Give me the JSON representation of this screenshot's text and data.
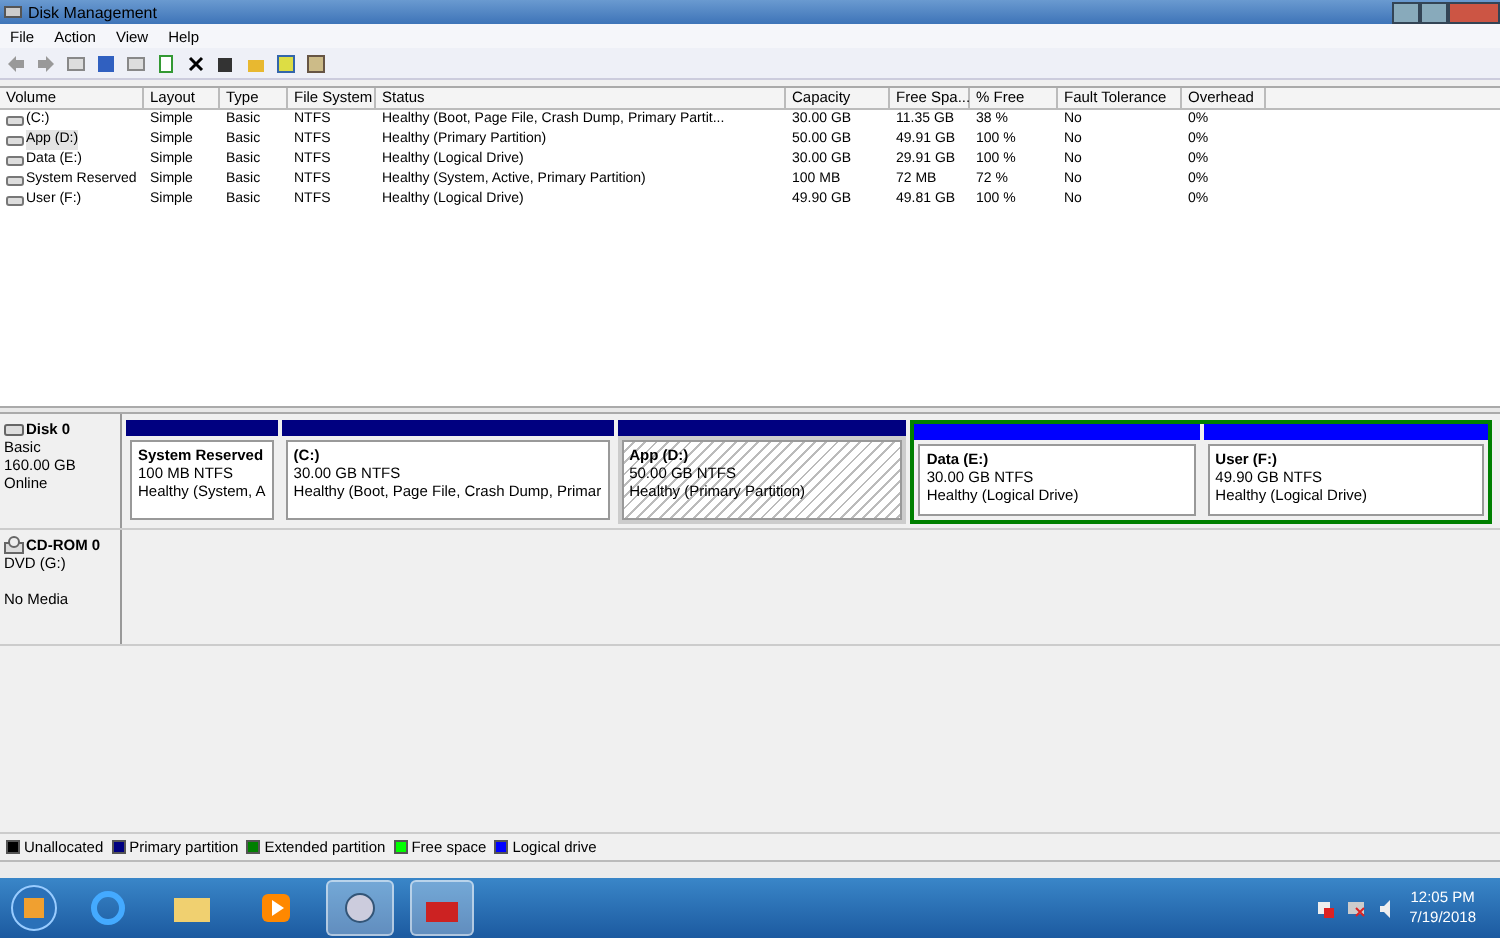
{
  "window": {
    "title": "Disk Management"
  },
  "menu": [
    "File",
    "Action",
    "View",
    "Help"
  ],
  "table": {
    "columns": [
      "Volume",
      "Layout",
      "Type",
      "File System",
      "Status",
      "Capacity",
      "Free Spa...",
      "% Free",
      "Fault Tolerance",
      "Overhead"
    ],
    "rows": [
      {
        "cells": [
          "(C:)",
          "Simple",
          "Basic",
          "NTFS",
          "Healthy (Boot, Page File, Crash Dump, Primary Partit...",
          "30.00 GB",
          "11.35 GB",
          "38 %",
          "No",
          "0%"
        ],
        "selected": false
      },
      {
        "cells": [
          "App (D:)",
          "Simple",
          "Basic",
          "NTFS",
          "Healthy (Primary Partition)",
          "50.00 GB",
          "49.91 GB",
          "100 %",
          "No",
          "0%"
        ],
        "selected": true
      },
      {
        "cells": [
          "Data (E:)",
          "Simple",
          "Basic",
          "NTFS",
          "Healthy (Logical Drive)",
          "30.00 GB",
          "29.91 GB",
          "100 %",
          "No",
          "0%"
        ],
        "selected": false
      },
      {
        "cells": [
          "System Reserved",
          "Simple",
          "Basic",
          "NTFS",
          "Healthy (System, Active, Primary Partition)",
          "100 MB",
          "72 MB",
          "72 %",
          "No",
          "0%"
        ],
        "selected": false
      },
      {
        "cells": [
          "User (F:)",
          "Simple",
          "Basic",
          "NTFS",
          "Healthy (Logical Drive)",
          "49.90 GB",
          "49.81 GB",
          "100 %",
          "No",
          "0%"
        ],
        "selected": false
      }
    ]
  },
  "disks": [
    {
      "kind": "disk",
      "name": "Disk 0",
      "lines": [
        "Basic",
        "160.00 GB"
      ],
      "status": "Online",
      "partitions": [
        {
          "kind": "primary",
          "name": "System Reserved",
          "size": "100 MB NTFS",
          "status": "Healthy (System, A",
          "selected": false
        },
        {
          "kind": "primary",
          "name": "(C:)",
          "size": "30.00 GB NTFS",
          "status": "Healthy (Boot, Page File, Crash Dump, Primar",
          "selected": false
        },
        {
          "kind": "primary",
          "name": "App  (D:)",
          "size": "50.00 GB NTFS",
          "status": "Healthy (Primary Partition)",
          "selected": true
        },
        {
          "kind": "extended",
          "children": [
            {
              "kind": "logical",
              "name": "Data  (E:)",
              "size": "30.00 GB NTFS",
              "status": "Healthy (Logical Drive)",
              "selected": false
            },
            {
              "kind": "logical",
              "name": "User  (F:)",
              "size": "49.90 GB NTFS",
              "status": "Healthy (Logical Drive)",
              "selected": false
            }
          ]
        }
      ]
    },
    {
      "kind": "cdrom",
      "name": "CD-ROM 0",
      "lines": [
        "DVD (G:)"
      ],
      "status": "No Media"
    }
  ],
  "legend": [
    {
      "label": "Unallocated",
      "color": "#000000"
    },
    {
      "label": "Primary partition",
      "color": "#000080"
    },
    {
      "label": "Extended partition",
      "color": "#008000"
    },
    {
      "label": "Free space",
      "color": "#00ff00"
    },
    {
      "label": "Logical drive",
      "color": "#0000ff"
    }
  ],
  "taskbar": {
    "time": "12:05 PM",
    "date": "7/19/2018"
  }
}
